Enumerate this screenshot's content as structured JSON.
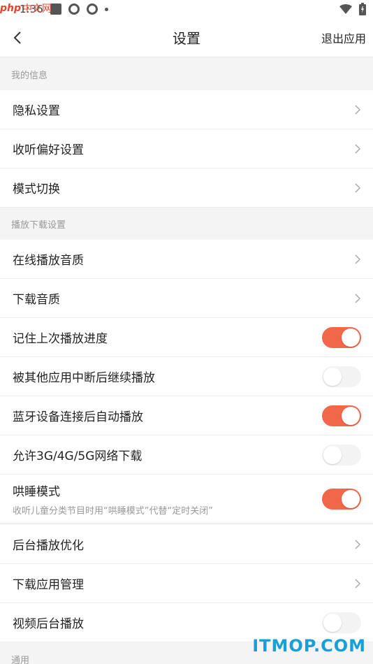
{
  "status_bar": {
    "time": "1:36",
    "watermark": {
      "php": "php",
      "cn": "中文网"
    },
    "icons": [
      "square-icon",
      "ring-icon",
      "ring-icon",
      "dot-icon",
      "wifi-icon",
      "battery-icon"
    ]
  },
  "nav": {
    "title": "设置",
    "right_action": "退出应用",
    "back_icon": "chevron-left-icon"
  },
  "sections": [
    {
      "label": "我的信息",
      "items": [
        {
          "label": "隐私设置",
          "type": "link"
        },
        {
          "label": "收听偏好设置",
          "type": "link"
        },
        {
          "label": "模式切换",
          "type": "link"
        }
      ]
    },
    {
      "label": "播放下载设置",
      "items": [
        {
          "label": "在线播放音质",
          "type": "link"
        },
        {
          "label": "下载音质",
          "type": "link"
        },
        {
          "label": "记住上次播放进度",
          "type": "toggle",
          "on": true
        },
        {
          "label": "被其他应用中断后继续播放",
          "type": "toggle",
          "on": false
        },
        {
          "label": "蓝牙设备连接后自动播放",
          "type": "toggle",
          "on": true
        },
        {
          "label": "允许3G/4G/5G网络下载",
          "type": "toggle",
          "on": false
        },
        {
          "label": "哄睡模式",
          "sub": "收听儿童分类节目时用“哄睡模式”代替“定时关闭”",
          "type": "toggle",
          "on": true
        },
        {
          "label": "后台播放优化",
          "type": "link"
        },
        {
          "label": "下载应用管理",
          "type": "link"
        },
        {
          "label": "视频后台播放",
          "type": "toggle",
          "on": false
        }
      ]
    },
    {
      "label": "通用",
      "items": []
    }
  ],
  "colors": {
    "accent": "#f0674a",
    "toggle_off": "#f3f3f3",
    "section_text": "#999999",
    "background": "#f4f4f4"
  },
  "watermark_bottom": "ITMOP.COM"
}
